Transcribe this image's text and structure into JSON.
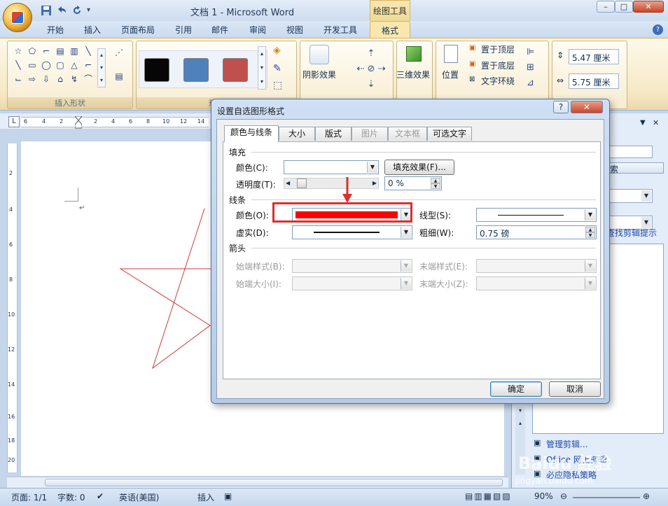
{
  "window": {
    "title": "文档 1 - Microsoft Word",
    "context_tab_group": "绘图工具",
    "controls": {
      "minimize": "–",
      "restore": "□",
      "close": "✕"
    }
  },
  "ribbon": {
    "tabs": [
      "开始",
      "插入",
      "页面布局",
      "引用",
      "邮件",
      "审阅",
      "视图",
      "开发工具",
      "格式"
    ],
    "active_tab": "格式",
    "groups": {
      "insert_shapes": {
        "label": "插入形状"
      },
      "shape_styles": {
        "label": "形状"
      },
      "shadow": {
        "label": "阴影效果"
      },
      "three_d": {
        "label": "三维效果"
      },
      "arrange": {
        "position": "位置",
        "bring_front": "置于顶层",
        "send_back": "置于底层",
        "text_wrap": "文字环绕"
      },
      "size": {
        "height": "5.47 厘米",
        "width": "5.75 厘米"
      }
    },
    "swatch_colors": [
      "#060606",
      "#4f81bd",
      "#c0504d"
    ]
  },
  "dialog": {
    "title": "设置自选图形格式",
    "help": "?",
    "close": "✕",
    "tabs": [
      "颜色与线条",
      "大小",
      "版式",
      "图片",
      "文本框",
      "可选文字"
    ],
    "active_tab": "颜色与线条",
    "disabled_tabs": [
      "图片",
      "文本框"
    ],
    "fill": {
      "section": "填充",
      "color_label": "颜色(C):",
      "fill_effects_button": "填充效果(F)...",
      "transparency_label": "透明度(T):",
      "transparency_value": "0 %"
    },
    "line": {
      "section": "线条",
      "color_label": "颜色(O):",
      "color_value": "#ff0000",
      "style_label": "线型(S):",
      "dash_label": "虚实(D):",
      "weight_label": "粗细(W):",
      "weight_value": "0.75 磅"
    },
    "arrows": {
      "section": "箭头",
      "begin_style": "始端样式(B):",
      "end_style": "末端样式(E):",
      "begin_size": "始端大小(I):",
      "end_size": "末端大小(Z):"
    },
    "ok": "确定",
    "cancel": "取消"
  },
  "taskpane": {
    "search_button": "索",
    "clip_tips": "查找剪辑提示",
    "organize": "管理剪辑...",
    "office_online": "Office 网上剪辑",
    "privacy": "必应隐私策略"
  },
  "statusbar": {
    "page": "页面: 1/1",
    "words": "字数: 0",
    "language": "英语(美国)",
    "mode": "插入",
    "zoom": "90%"
  },
  "ruler_numbers": [
    "6",
    "4",
    "2",
    "2",
    "4",
    "6",
    "8",
    "10",
    "12",
    "14"
  ],
  "vruler_numbers": [
    "2",
    "4",
    "6",
    "8",
    "10",
    "12",
    "14",
    "16",
    "18",
    "20"
  ],
  "watermark": "Baidu 经验",
  "watermark_sub": "jingyan.baidu.com",
  "colors": {
    "annotation_red": "#d93030",
    "star_stroke": "#d33a3a",
    "ribbon_active": "#fbe7ad"
  }
}
